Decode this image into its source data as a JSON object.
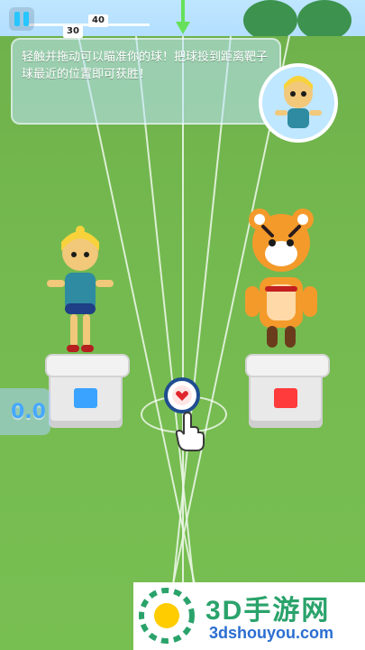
{
  "hud": {
    "meter": {
      "left_value": "30",
      "right_value": "40",
      "top_small": "30"
    }
  },
  "hint": {
    "text": "轻触并拖动可以瞄准你的球！把球投到距离靶子球最近的位置即可获胜！"
  },
  "score": {
    "value": "0.0"
  },
  "watermark": {
    "title": "3D手游网",
    "subtitle": "3dshouyou.com"
  },
  "colors": {
    "field": "#78bf52",
    "lane": "#e9f5e4",
    "accent": "#27c6ff",
    "score": "#46a8ff",
    "pedestal_face_left": "#3aa3ff",
    "pedestal_face_right": "#ff3b3b",
    "wm_green": "#2aa36b",
    "wm_blue": "#2b6ed1"
  },
  "icons": {
    "pause": "pause-icon",
    "heart": "heart-icon",
    "hand": "hand-pointer-icon",
    "arrow": "down-arrow-icon",
    "logo": "logo-icon"
  }
}
